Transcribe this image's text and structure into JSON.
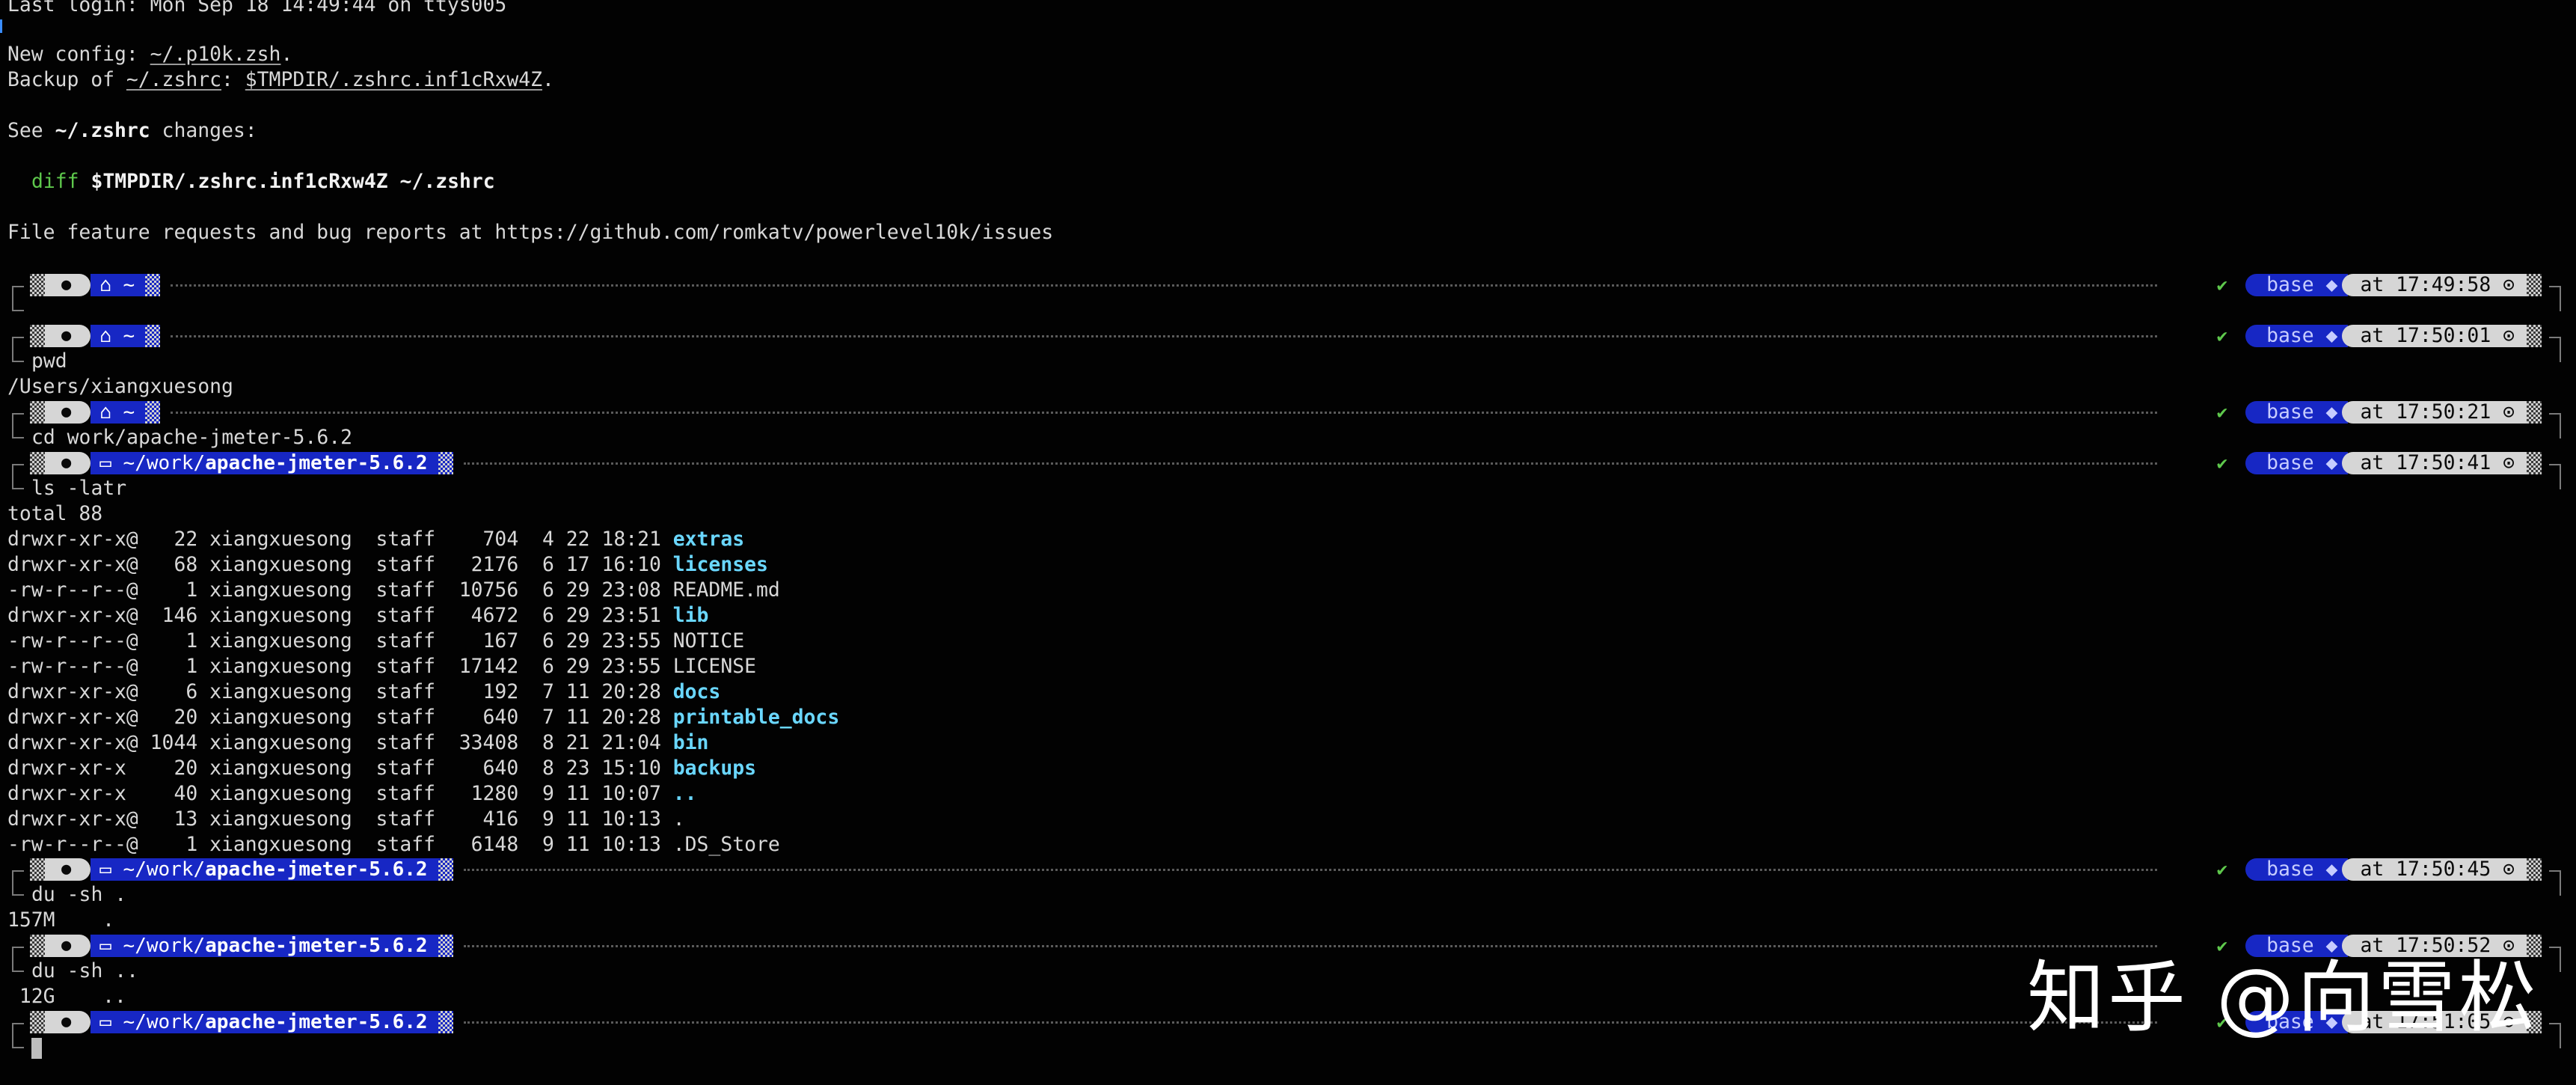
{
  "header_lines": {
    "last_login": "Last login: Mon Sep 18 14:49:44 on ttys005",
    "new_config_label": "New config: ",
    "new_config_path": "~/.p10k.zsh",
    "new_config_end": ".",
    "backup_label": "Backup of ",
    "backup_path": "~/.zshrc",
    "backup_sep": ": ",
    "backup_target": "$TMPDIR/.zshrc.inf1cRxw4Z",
    "backup_end": ".",
    "see_label": "See ",
    "see_file": "~/.zshrc",
    "see_end": " changes:",
    "diff_cmd": "diff",
    "diff_args": " $TMPDIR/.zshrc.inf1cRxw4Z ~/.zshrc",
    "issues": "File feature requests and bug reports at https://github.com/romkatv/powerlevel10k/issues"
  },
  "icons": {
    "os": "apple-logo",
    "home": "home-icon",
    "folder": "folder-icon",
    "clock": "clock-icon",
    "check": "check-mark"
  },
  "prompts": [
    {
      "path_pre": "⌂ ~",
      "path_bold": "",
      "env": "base ◆",
      "time": "at 17:49:58 ⊙",
      "cmd": "",
      "output": []
    },
    {
      "path_pre": "⌂ ~",
      "path_bold": "",
      "env": "base ◆",
      "time": "at 17:50:01 ⊙",
      "cmd": "pwd",
      "output": [
        "/Users/xiangxuesong"
      ]
    },
    {
      "path_pre": "⌂ ~",
      "path_bold": "",
      "env": "base ◆",
      "time": "at 17:50:21 ⊙",
      "cmd": "cd work/apache-jmeter-5.6.2",
      "output": []
    },
    {
      "path_pre": "▭ ~/work/",
      "path_bold": "apache-jmeter-5.6.2",
      "env": "base ◆",
      "time": "at 17:50:41 ⊙",
      "cmd": "ls -latr",
      "output": [
        "total 88"
      ]
    },
    {
      "path_pre": "▭ ~/work/",
      "path_bold": "apache-jmeter-5.6.2",
      "env": "base ◆",
      "time": "at 17:50:45 ⊙",
      "cmd": "du -sh .",
      "output": [
        "157M    ."
      ]
    },
    {
      "path_pre": "▭ ~/work/",
      "path_bold": "apache-jmeter-5.6.2",
      "env": "base ◆",
      "time": "at 17:50:52 ⊙",
      "cmd": "du -sh ..",
      "output": [
        " 12G    .."
      ]
    },
    {
      "path_pre": "▭ ~/work/",
      "path_bold": "apache-jmeter-5.6.2",
      "env": "base ◆",
      "time": "at 17:51:05 ⊙",
      "cmd": "",
      "output": []
    }
  ],
  "ls_rows": [
    {
      "meta": "drwxr-xr-x@   22 xiangxuesong  staff    704  4 22 18:21 ",
      "name": "extras",
      "dir": true
    },
    {
      "meta": "drwxr-xr-x@   68 xiangxuesong  staff   2176  6 17 16:10 ",
      "name": "licenses",
      "dir": true
    },
    {
      "meta": "-rw-r--r--@    1 xiangxuesong  staff  10756  6 29 23:08 ",
      "name": "README.md",
      "dir": false
    },
    {
      "meta": "drwxr-xr-x@  146 xiangxuesong  staff   4672  6 29 23:51 ",
      "name": "lib",
      "dir": true
    },
    {
      "meta": "-rw-r--r--@    1 xiangxuesong  staff    167  6 29 23:55 ",
      "name": "NOTICE",
      "dir": false
    },
    {
      "meta": "-rw-r--r--@    1 xiangxuesong  staff  17142  6 29 23:55 ",
      "name": "LICENSE",
      "dir": false
    },
    {
      "meta": "drwxr-xr-x@    6 xiangxuesong  staff    192  7 11 20:28 ",
      "name": "docs",
      "dir": true
    },
    {
      "meta": "drwxr-xr-x@   20 xiangxuesong  staff    640  7 11 20:28 ",
      "name": "printable_docs",
      "dir": true
    },
    {
      "meta": "drwxr-xr-x@ 1044 xiangxuesong  staff  33408  8 21 21:04 ",
      "name": "bin",
      "dir": true
    },
    {
      "meta": "drwxr-xr-x    20 xiangxuesong  staff    640  8 23 15:10 ",
      "name": "backups",
      "dir": true
    },
    {
      "meta": "drwxr-xr-x    40 xiangxuesong  staff   1280  9 11 10:07 ",
      "name": "..",
      "dir": true
    },
    {
      "meta": "drwxr-xr-x@   13 xiangxuesong  staff    416  9 11 10:13 ",
      "name": ".",
      "dir": false
    },
    {
      "meta": "-rw-r--r--@    1 xiangxuesong  staff   6148  9 11 10:13 ",
      "name": ".DS_Store",
      "dir": false
    }
  ],
  "watermark": "知乎 @向雪松",
  "colors": {
    "background": "#020202",
    "segment_blue": "#1727c4",
    "segment_grey": "#d6d6d6",
    "ok_green": "#5ec84c",
    "dir_cyan": "#6ad7ff"
  }
}
